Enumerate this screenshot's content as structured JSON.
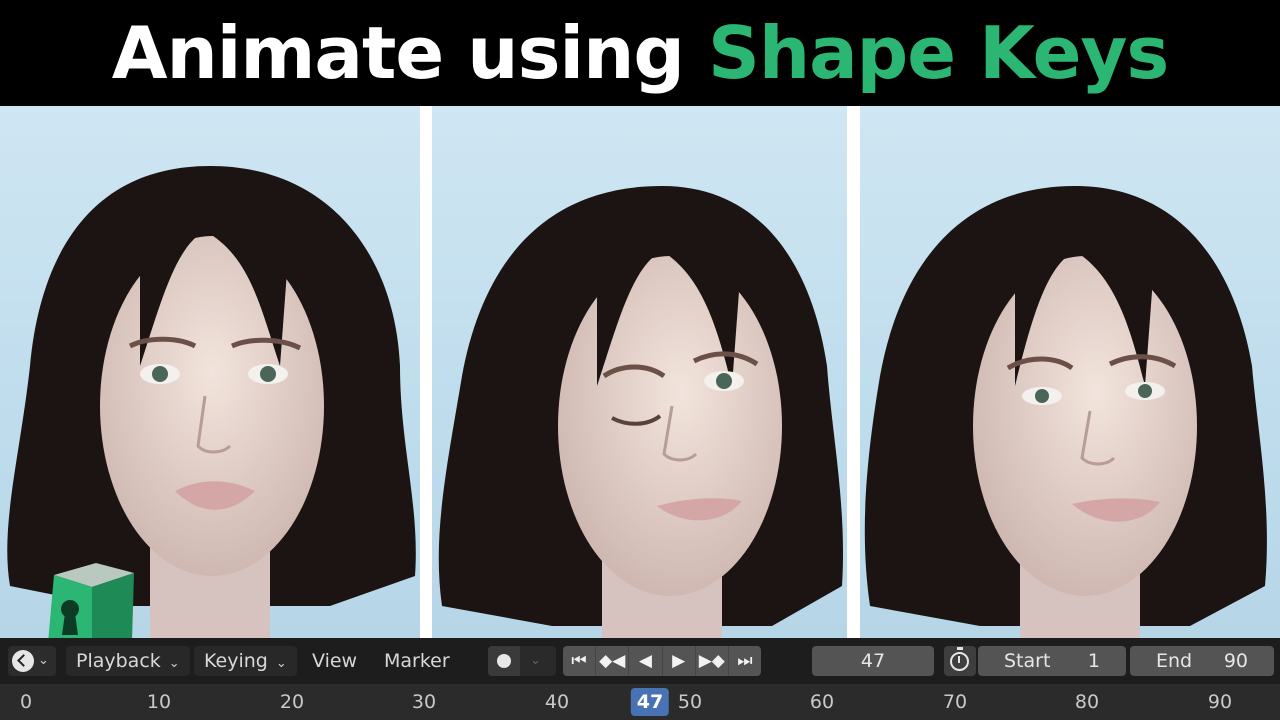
{
  "banner": {
    "title_part1": "Animate using ",
    "title_part2": "Shape Keys",
    "accent_color": "#2bb673"
  },
  "renders": [
    {
      "name": "neutral-face-render",
      "expression": "neutral"
    },
    {
      "name": "wink-face-render",
      "expression": "wink"
    },
    {
      "name": "smile-face-render",
      "expression": "smile"
    }
  ],
  "logo": {
    "icon": "keyhole-cube-icon",
    "color": "#2bb673"
  },
  "timeline": {
    "editor_type_icon": "clock-editor-icon",
    "menus": {
      "playback": "Playback",
      "keying": "Keying",
      "view": "View",
      "marker": "Marker"
    },
    "record_icon": "record-dot-icon",
    "transport": {
      "jump_start": "⏮",
      "prev_keyframe": "◆◀",
      "play_reverse": "◀",
      "play": "▶",
      "next_keyframe": "▶◆",
      "jump_end": "⏭"
    },
    "current_frame": "47",
    "start_label": "Start",
    "start_value": "1",
    "end_label": "End",
    "end_value": "90"
  },
  "ruler": {
    "ticks": [
      "0",
      "10",
      "20",
      "30",
      "40",
      "50",
      "60",
      "70",
      "80",
      "90"
    ],
    "playhead": "47"
  }
}
